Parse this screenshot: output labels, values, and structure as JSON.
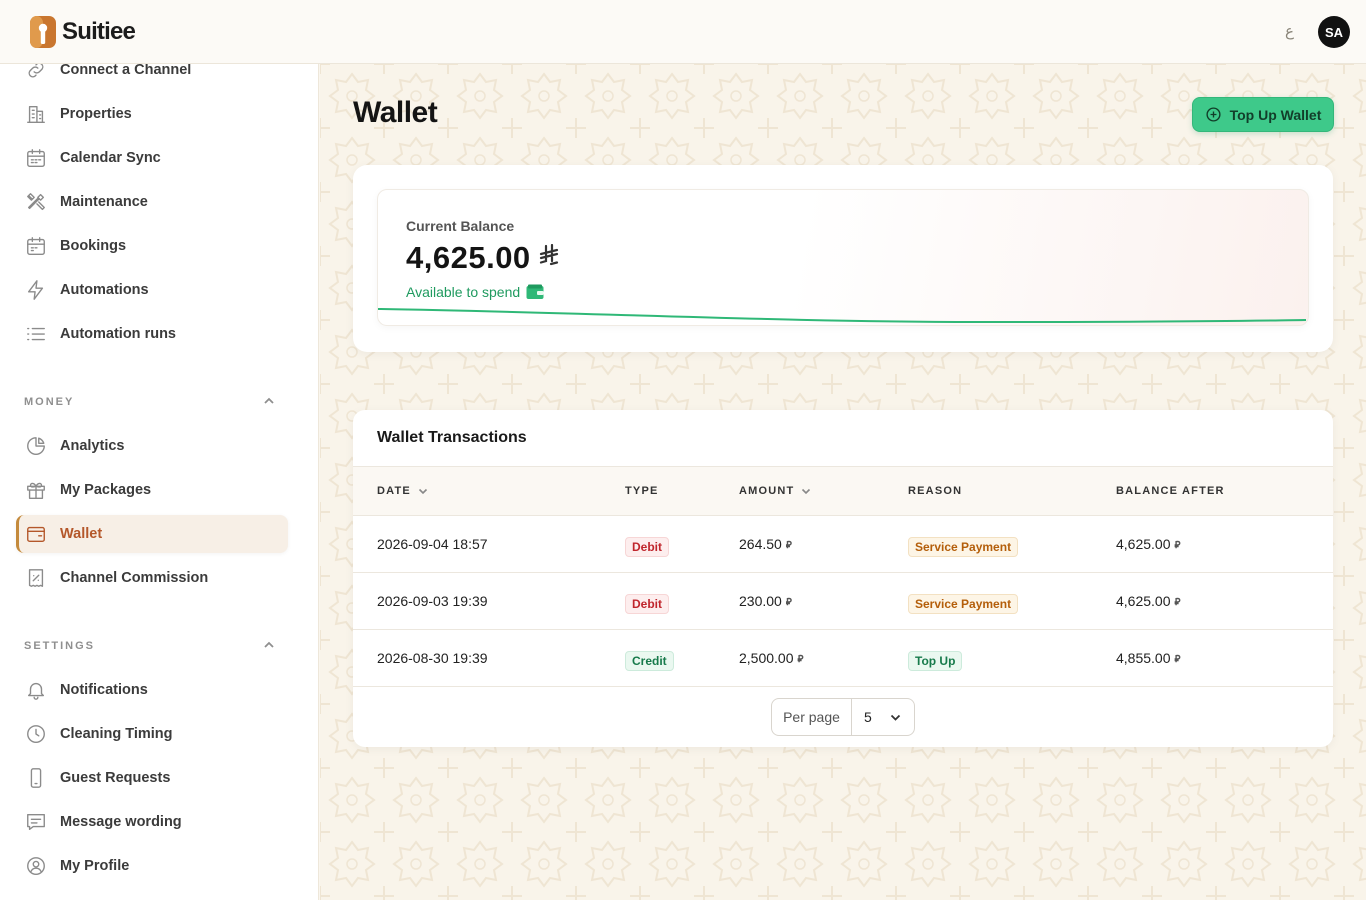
{
  "header": {
    "brand": "Suitiee",
    "lang_toggle": "ع",
    "avatar_initials": "SA"
  },
  "sidebar": {
    "items_top": [
      {
        "label": "Connect a Channel",
        "icon": "link-icon"
      },
      {
        "label": "Properties",
        "icon": "building-icon"
      },
      {
        "label": "Calendar Sync",
        "icon": "calendar-icon"
      },
      {
        "label": "Maintenance",
        "icon": "tools-icon"
      },
      {
        "label": "Bookings",
        "icon": "calendar-icon"
      },
      {
        "label": "Automations",
        "icon": "bolt-icon"
      },
      {
        "label": "Automation runs",
        "icon": "list-icon"
      }
    ],
    "money_title": "MONEY",
    "money_items": [
      {
        "label": "Analytics",
        "icon": "pie-chart-icon"
      },
      {
        "label": "My Packages",
        "icon": "gift-icon"
      },
      {
        "label": "Wallet",
        "icon": "wallet-icon",
        "active": true
      },
      {
        "label": "Channel Commission",
        "icon": "percent-receipt-icon"
      }
    ],
    "settings_title": "SETTINGS",
    "settings_items": [
      {
        "label": "Notifications",
        "icon": "bell-icon"
      },
      {
        "label": "Cleaning Timing",
        "icon": "clock-icon"
      },
      {
        "label": "Guest Requests",
        "icon": "phone-icon"
      },
      {
        "label": "Message wording",
        "icon": "message-icon"
      },
      {
        "label": "My Profile",
        "icon": "user-circle-icon"
      }
    ]
  },
  "main": {
    "title": "Wallet",
    "topup_label": "Top Up Wallet",
    "balance": {
      "label": "Current Balance",
      "amount": "4,625.00",
      "currency_symbol": "⃁",
      "sub": "Available to spend"
    },
    "transactions": {
      "title": "Wallet Transactions",
      "columns": [
        "DATE",
        "TYPE",
        "AMOUNT",
        "REASON",
        "BALANCE AFTER"
      ],
      "rows": [
        {
          "date": "2026-09-04 18:57",
          "type": "Debit",
          "amount": "264.50",
          "reason": "Service Payment",
          "balance_after": "4,625.00"
        },
        {
          "date": "2026-09-03 19:39",
          "type": "Debit",
          "amount": "230.00",
          "reason": "Service Payment",
          "balance_after": "4,625.00"
        },
        {
          "date": "2026-08-30 19:39",
          "type": "Credit",
          "amount": "2,500.00",
          "reason": "Top Up",
          "balance_after": "4,855.00"
        }
      ],
      "per_page_label": "Per page",
      "per_page_value": "5"
    }
  },
  "colors": {
    "accent_green": "#3ec98a",
    "active_nav": "#b4572a",
    "debit": "#c0262d",
    "credit": "#177a4b",
    "service": "#b45e0a"
  }
}
